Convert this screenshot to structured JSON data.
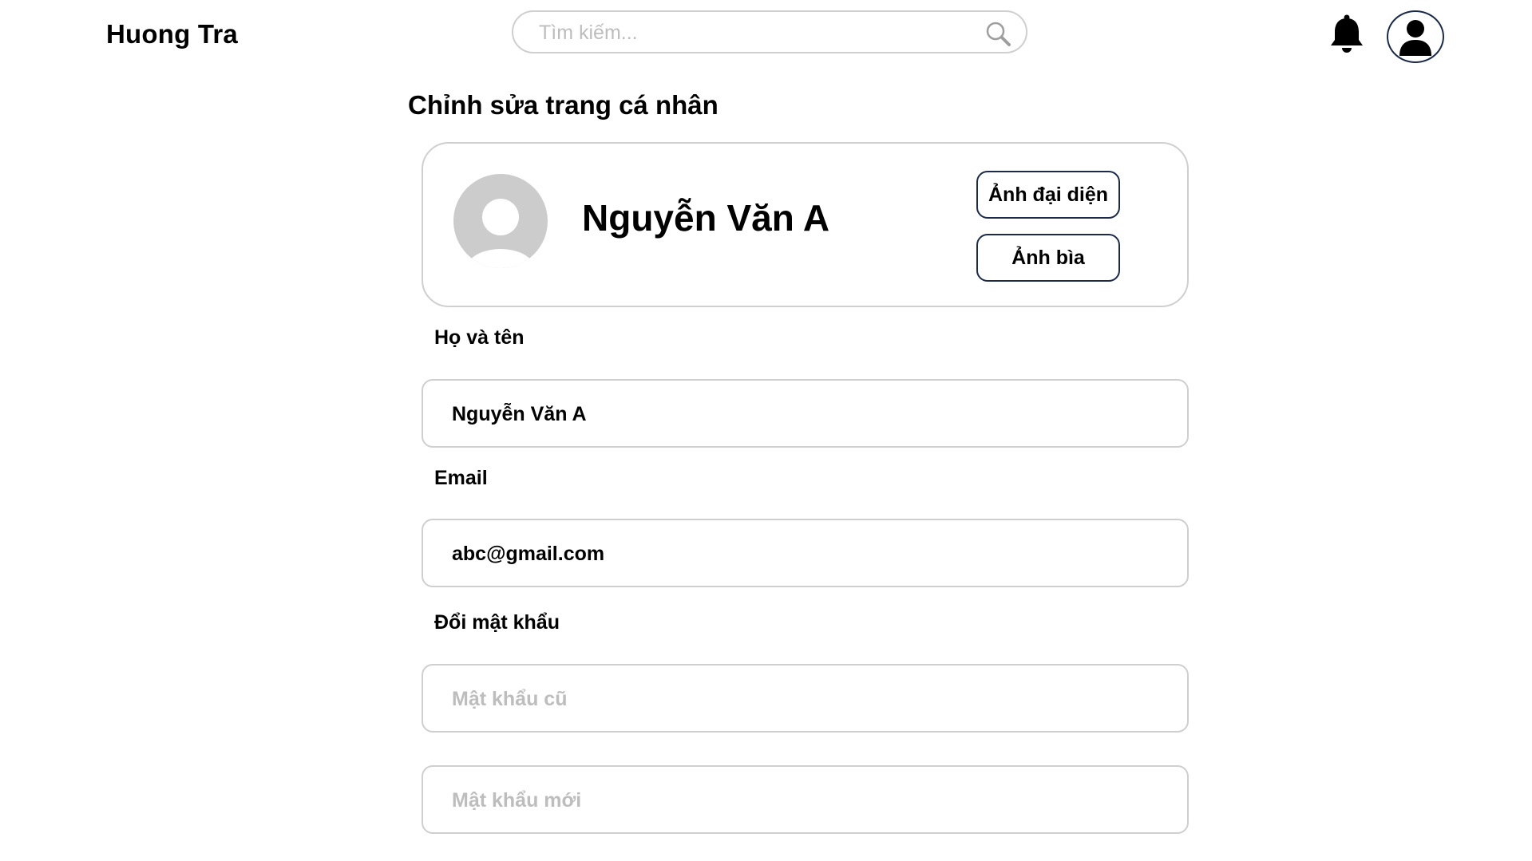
{
  "header": {
    "brand": "Huong Tra",
    "search_placeholder": "Tìm kiếm...",
    "icons": [
      "search-icon",
      "bell-icon",
      "user-icon"
    ]
  },
  "page": {
    "title": "Chỉnh sửa trang cá nhân"
  },
  "profile": {
    "name": "Nguyễn Văn A",
    "avatar_button": "Ảnh đại diện",
    "cover_button": "Ảnh bìa"
  },
  "form": {
    "fullname_label": "Họ và tên",
    "fullname_value": "Nguyễn Văn A",
    "email_label": "Email",
    "email_value": "abc@gmail.com",
    "password_label": "Đổi mật khẩu",
    "old_password_placeholder": "Mật khẩu cũ",
    "new_password_placeholder": "Mật khẩu mới"
  },
  "colors": {
    "border": "#cfcfcf",
    "button_border": "#1c2a4a",
    "avatar_placeholder": "#cccccc",
    "placeholder_text": "#bdbdbd"
  }
}
